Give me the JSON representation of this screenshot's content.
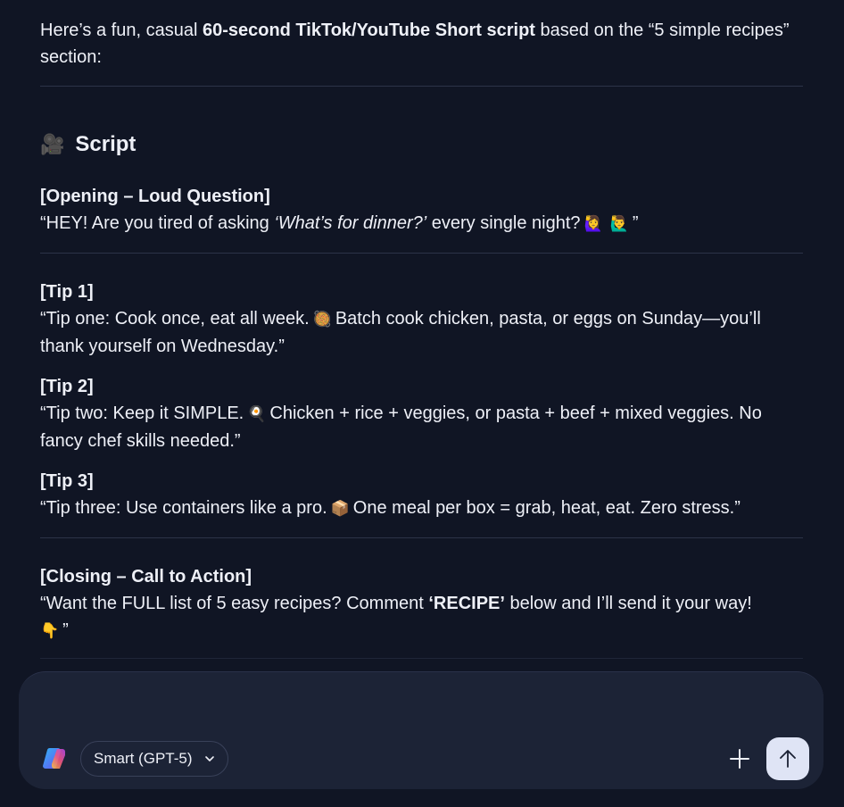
{
  "message": {
    "intro_prefix": "Here’s a fun, casual ",
    "intro_bold": "60-second TikTok/YouTube Short script",
    "intro_suffix": " based on the “5 simple recipes” section:",
    "heading_emoji": "🎥",
    "heading": "Script",
    "opening": {
      "label": "[Opening – Loud Question]",
      "text_a": "“HEY! Are you tired of asking ",
      "text_italic": "‘What’s for dinner?’",
      "text_b": " every single night?",
      "emoji1": "🙋‍♀️",
      "emoji2": "🙋‍♂️",
      "text_end": "”"
    },
    "tip1": {
      "label": "[Tip 1]",
      "text_a": "“Tip one: Cook once, eat all week.",
      "emoji": "🥘",
      "text_b": "Batch cook chicken, pasta, or eggs on Sunday—you’ll thank yourself on Wednesday.”"
    },
    "tip2": {
      "label": "[Tip 2]",
      "text_a": "“Tip two: Keep it SIMPLE.",
      "emoji": "🍳",
      "text_b": "Chicken + rice + veggies, or pasta + beef + mixed veggies. No fancy chef skills needed.”"
    },
    "tip3": {
      "label": "[Tip 3]",
      "text_a": "“Tip three: Use containers like a pro.",
      "emoji": "📦",
      "text_b": "One meal per box = grab, heat, eat. Zero stress.”"
    },
    "closing": {
      "label": "[Closing – Call to Action]",
      "text_a": "“Want the FULL list of 5 easy recipes? Comment ",
      "text_bold": "‘RECIPE’",
      "text_b": " below and I’ll send it your way!",
      "emoji": "👇",
      "text_end": "”"
    }
  },
  "composer": {
    "placeholder": "",
    "model_label": "Smart (GPT-5)",
    "logo_icon": "copilot-logo-icon",
    "model_icon": "chevron-down-icon",
    "add_icon": "plus-icon",
    "send_icon": "arrow-up-icon"
  },
  "colors": {
    "background": "#101524",
    "composer": "#1c2336",
    "send_button": "#dfe4f5"
  }
}
